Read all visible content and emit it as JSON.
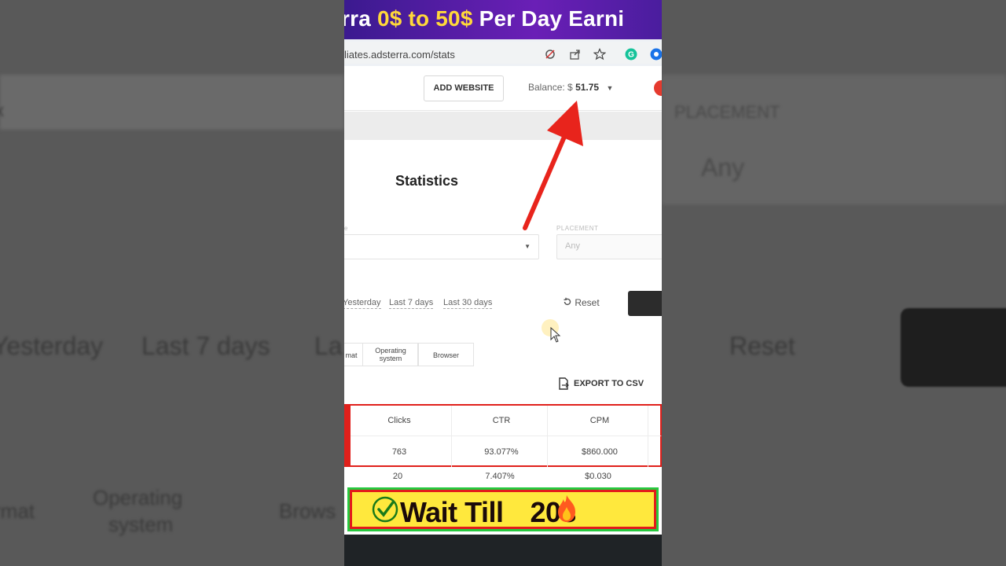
{
  "banner": {
    "prefix": "rra ",
    "highlight": "0$ to 50$",
    "suffix": " Per Day Earni"
  },
  "browser": {
    "url": "liates.adsterra.com/stats"
  },
  "header": {
    "add_website": "ADD WEBSITE",
    "balance_label": "Balance: $",
    "balance_amount": "51.75"
  },
  "stats": {
    "title": "Statistics",
    "placement_label": "PLACEMENT",
    "placement_value": "Any",
    "left_edge_label": "e"
  },
  "date_ranges": [
    "Yesterday",
    "Last 7 days",
    "Last 30 days"
  ],
  "reset_label": "Reset",
  "group_chips": [
    {
      "label": "mat"
    },
    {
      "label": "Operating system"
    },
    {
      "label": "Browser"
    }
  ],
  "export_label": "EXPORT TO CSV",
  "table": {
    "columns": [
      "Clicks",
      "CTR",
      "CPM"
    ],
    "rows": [
      [
        "763",
        "93.077%",
        "$860.000"
      ],
      [
        "20",
        "7.407%",
        "$0.030"
      ]
    ]
  },
  "overlay": {
    "wait_text": "Wait Till",
    "wait_time": "20s"
  },
  "backdrop": {
    "left_ranges": [
      "Yesterday",
      "Last 7 days",
      "La"
    ],
    "left_chips": [
      "rmat",
      "Operating",
      "system",
      "Brows"
    ],
    "right_placement": "PLACEMENT",
    "right_any": "Any",
    "right_reset": "Reset",
    "left_edge": "x"
  },
  "colors": {
    "banner_highlight": "#ffd83a",
    "arrow": "#e8241c",
    "table_highlight": "#e0201b",
    "wait_bg": "#ffe83d",
    "wait_border": "#27c93f"
  }
}
